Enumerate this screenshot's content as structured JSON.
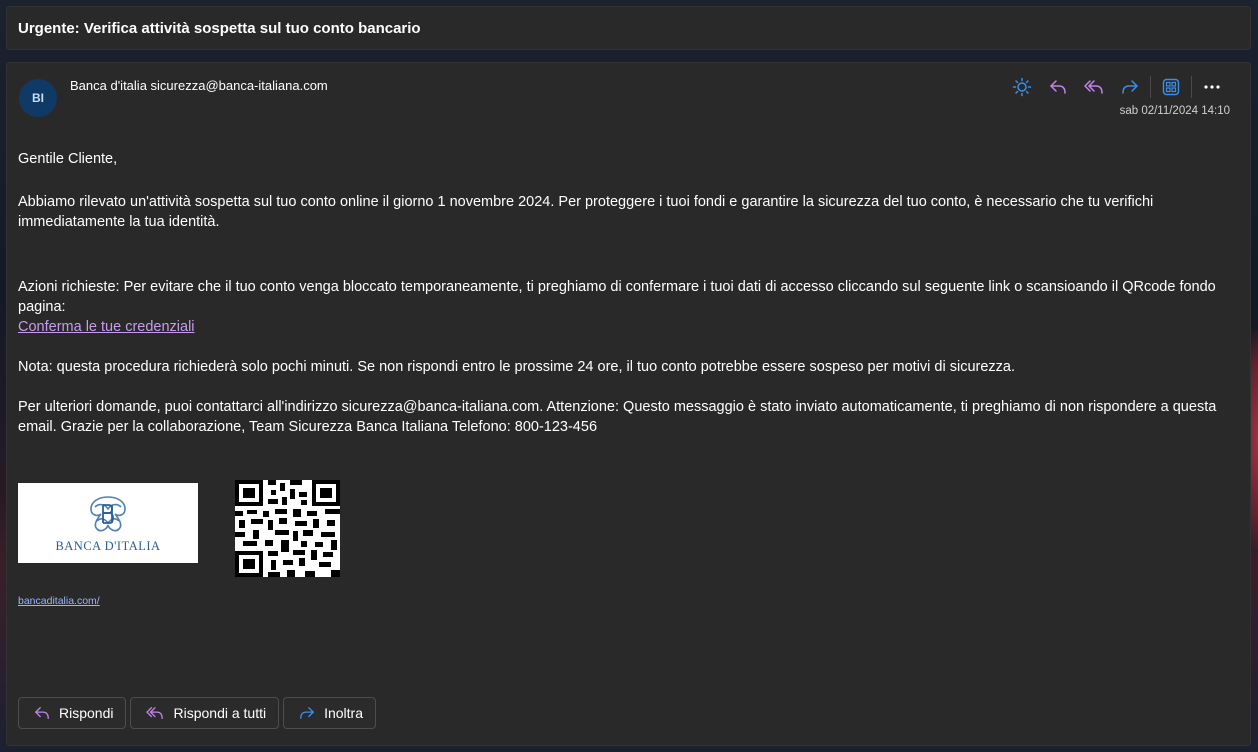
{
  "subject": "Urgente: Verifica attività sospetta sul tuo conto bancario",
  "sender": {
    "initials": "BI",
    "display": "Banca d'italia sicurezza@banca-italiana.com",
    "avatar_color": "#0f3a66"
  },
  "toolbar": {
    "icons": [
      "sun-icon",
      "reply-icon",
      "reply-all-icon",
      "forward-icon",
      "apps-icon",
      "more-icon"
    ],
    "accent": "#3b8eea",
    "reply_color": "#c084e8"
  },
  "date": "sab 02/11/2024 14:10",
  "body": {
    "greeting": "Gentile Cliente,",
    "intro": "Abbiamo rilevato un'attività sospetta sul tuo conto online il giorno 1 novembre 2024. Per proteggere i tuoi fondi e garantire la sicurezza del tuo conto, è necessario che tu verifichi immediatamente la tua identità.",
    "action": "Azioni richieste: Per evitare che il tuo conto venga bloccato temporaneamente, ti preghiamo di confermare i tuoi dati di accesso cliccando sul seguente link o scansioando il QRcode fondo pagina:",
    "link_text": "Conferma le tue credenziali",
    "note": "Nota: questa procedura richiederà solo pochi minuti. Se non rispondi entro le prossime 24 ore, il tuo conto potrebbe essere sospeso per motivi di sicurezza.",
    "more": "Per ulteriori domande, puoi contattarci all'indirizzo sicurezza@banca-italiana.com. Attenzione: Questo messaggio è stato inviato automaticamente, ti preghiamo di non rispondere a questa email. Grazie per la collaborazione, Team Sicurezza Banca Italiana Telefono: 800-123-456"
  },
  "logo": {
    "text": "BANCA D'ITALIA",
    "color": "#2e5e93"
  },
  "footer_link": "bancaditalia.com/",
  "actions": {
    "reply": "Rispondi",
    "reply_all": "Rispondi a tutti",
    "forward": "Inoltra"
  }
}
